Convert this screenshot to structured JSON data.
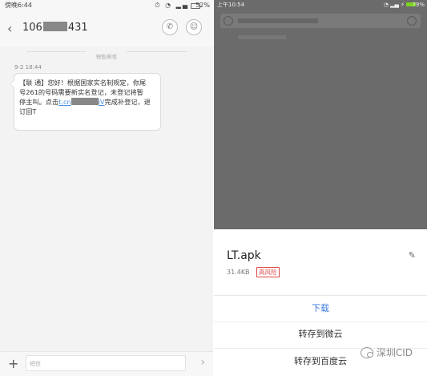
{
  "sms": {
    "status_bar": {
      "time": "傍晚6:44",
      "battery": "52%"
    },
    "header": {
      "contact_prefix": "106",
      "contact_suffix": "431"
    },
    "divider": "短信/彩信",
    "timestamp": "9-2 18:44",
    "message": {
      "line1": "【联 通】您好！根据国家实名制规定，你尾",
      "line2": "号261的号码需要新实名登记，未登记将暂",
      "line3_pre": "停主叫。点击",
      "link_pre": "t.cn",
      "link_post": "iV",
      "line3_post": "完成补登记，退",
      "line4": "订回T"
    },
    "input_placeholder": "短信"
  },
  "browser": {
    "status_bar": {
      "time": "上午10:54",
      "battery": "79%"
    },
    "file": {
      "name": "LT.apk",
      "size": "31.4KB",
      "risk_label": "高风险"
    },
    "actions": {
      "download": "下载",
      "save_weiyun": "转存到微云",
      "save_baidu": "转存到百度云"
    },
    "watermark": "深圳CID"
  }
}
